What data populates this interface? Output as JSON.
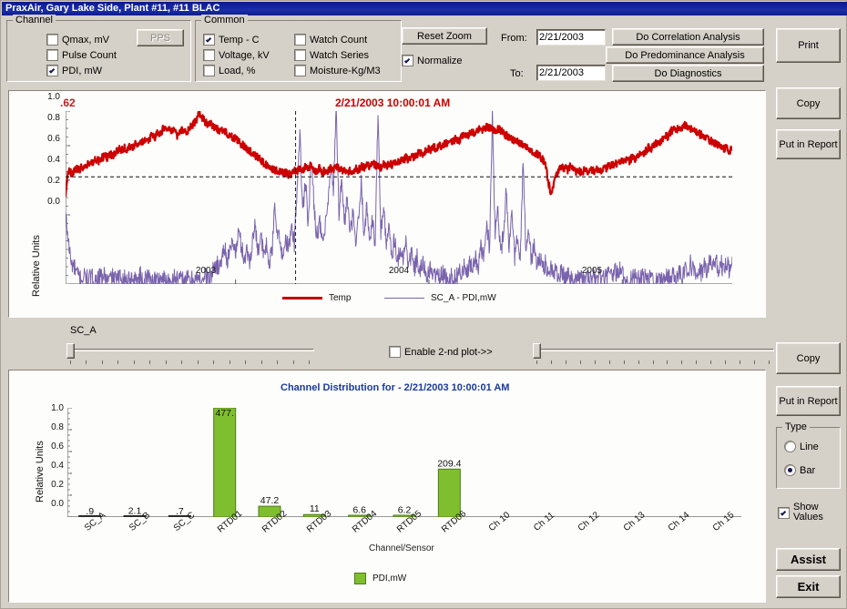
{
  "window": {
    "title": "PraxAir, Gary Lake Side, Plant #11, #11 BLAC"
  },
  "channel_group": {
    "title": "Channel",
    "items": [
      {
        "label": "Qmax, mV",
        "checked": false
      },
      {
        "label": "Pulse Count",
        "checked": false
      },
      {
        "label": "PDI, mW",
        "checked": true
      }
    ],
    "pps_button": "PPS"
  },
  "common_group": {
    "title": "Common",
    "items": [
      {
        "label": "Temp - C",
        "checked": true
      },
      {
        "label": "Voltage, kV",
        "checked": false
      },
      {
        "label": "Load, %",
        "checked": false
      },
      {
        "label": "Watch Count",
        "checked": false
      },
      {
        "label": "Watch Series",
        "checked": false
      },
      {
        "label": "Moisture-Kg/M3",
        "checked": false
      }
    ]
  },
  "zoom_group": {
    "reset_button": "Reset Zoom",
    "normalize_label": "Normalize",
    "normalize_checked": true
  },
  "daterange": {
    "from_label": "From:",
    "from_value": "2/21/2003",
    "to_label": "To:",
    "to_value": "2/21/2003"
  },
  "analysis_buttons": [
    "Do Correlation Analysis",
    "Do Predominance Analysis",
    "Do Diagnostics"
  ],
  "right_top_buttons": [
    "Print",
    "Copy",
    "Put in Report"
  ],
  "right_bottom_buttons": [
    "Copy",
    "Put in Report"
  ],
  "type_group": {
    "title": "Type",
    "options": [
      {
        "label": "Line",
        "selected": false
      },
      {
        "label": "Bar",
        "selected": true
      }
    ]
  },
  "show_values": {
    "label_line1": "Show",
    "label_line2": "Values",
    "checked": true
  },
  "assist_button": "Assist",
  "exit_button": "Exit",
  "slider_section": {
    "channel_label": "SC_A",
    "enable_2nd_plot_label": "Enable 2-nd plot->>",
    "enable_2nd_plot_checked": false
  },
  "colors": {
    "temp_line": "#cc0000",
    "pdi_line": "#7a63ad",
    "bar_fill": "#7fbf2f",
    "bar_edge": "#4c7a18",
    "title_blue": "#1a3a9c",
    "marker_red": "#bb2222",
    "titlebar_blue": "#13249c",
    "face": "#d5d0c8"
  },
  "chart_data": [
    {
      "id": "trend-chart",
      "type": "line",
      "title": "2/21/2003 10:00:01 AM",
      "corner_value": ".62",
      "ylabel": "Relative Units",
      "xlabel": "",
      "ylim": [
        0.0,
        1.0
      ],
      "yticks": [
        "0.0",
        "0.2",
        "0.4",
        "0.6",
        "0.8",
        "1.0"
      ],
      "ytick_values": [
        0.0,
        0.2,
        0.4,
        0.6,
        0.8,
        1.0
      ],
      "xticks": [
        "2003",
        "2004",
        "2005"
      ],
      "xtick_positions": [
        0.255,
        0.545,
        0.835
      ],
      "threshold_line": 0.62,
      "cursor_position": 0.345,
      "legend_position": "bottom",
      "series": [
        {
          "name": "Temp",
          "color": "#cc0000",
          "values": [
            0.51,
            0.66,
            0.64,
            0.65,
            0.67,
            0.66,
            0.68,
            0.67,
            0.69,
            0.7,
            0.71,
            0.72,
            0.71,
            0.73,
            0.74,
            0.73,
            0.75,
            0.74,
            0.76,
            0.78,
            0.77,
            0.79,
            0.78,
            0.8,
            0.79,
            0.81,
            0.8,
            0.82,
            0.83,
            0.82,
            0.84,
            0.86,
            0.85,
            0.88,
            0.87,
            0.9,
            0.89,
            0.91,
            0.88,
            0.9,
            0.86,
            0.88,
            0.9,
            0.87,
            0.89,
            0.91,
            0.93,
            0.95,
            0.99,
            0.96,
            0.94,
            0.92,
            0.93,
            0.91,
            0.9,
            0.89,
            0.9,
            0.88,
            0.87,
            0.86,
            0.85,
            0.84,
            0.82,
            0.81,
            0.8,
            0.78,
            0.77,
            0.76,
            0.74,
            0.73,
            0.72,
            0.7,
            0.69,
            0.68,
            0.67,
            0.66,
            0.65,
            0.66,
            0.64,
            0.65,
            0.63,
            0.64,
            0.66,
            0.65,
            0.67,
            0.66,
            0.68,
            0.67,
            0.69,
            0.66,
            0.65,
            0.67,
            0.64,
            0.66,
            0.65,
            0.67,
            0.66,
            0.68,
            0.67,
            0.66,
            0.65,
            0.64,
            0.66,
            0.65,
            0.67,
            0.66,
            0.68,
            0.67,
            0.69,
            0.68,
            0.7,
            0.69,
            0.68,
            0.67,
            0.69,
            0.68,
            0.7,
            0.69,
            0.71,
            0.7,
            0.72,
            0.71,
            0.73,
            0.72,
            0.74,
            0.73,
            0.75,
            0.76,
            0.75,
            0.77,
            0.78,
            0.77,
            0.79,
            0.78,
            0.8,
            0.79,
            0.81,
            0.82,
            0.81,
            0.83,
            0.84,
            0.83,
            0.85,
            0.86,
            0.85,
            0.87,
            0.88,
            0.87,
            0.89,
            0.9,
            0.89,
            0.91,
            0.9,
            0.89,
            0.88,
            0.9,
            0.89,
            0.87,
            0.86,
            0.85,
            0.84,
            0.83,
            0.82,
            0.81,
            0.8,
            0.79,
            0.78,
            0.77,
            0.76,
            0.75,
            0.74,
            0.72,
            0.7,
            0.6,
            0.52,
            0.58,
            0.63,
            0.66,
            0.68,
            0.67,
            0.66,
            0.68,
            0.67,
            0.65,
            0.66,
            0.64,
            0.66,
            0.65,
            0.67,
            0.66,
            0.65,
            0.67,
            0.66,
            0.68,
            0.67,
            0.69,
            0.68,
            0.7,
            0.69,
            0.71,
            0.7,
            0.72,
            0.71,
            0.73,
            0.72,
            0.74,
            0.76,
            0.75,
            0.77,
            0.79,
            0.78,
            0.8,
            0.82,
            0.81,
            0.84,
            0.86,
            0.85,
            0.88,
            0.9,
            0.89,
            0.91,
            0.9,
            0.92,
            0.91,
            0.89,
            0.9,
            0.88,
            0.87,
            0.86,
            0.85,
            0.84,
            0.83,
            0.82,
            0.81,
            0.8,
            0.79,
            0.78,
            0.79,
            0.77,
            0.78
          ]
        },
        {
          "name": "SC_A - PDI,mW",
          "color": "#7a63ad",
          "values": [
            0.4,
            0.25,
            0.12,
            0.1,
            0.06,
            0.04,
            0.03,
            0.05,
            0.02,
            0.04,
            0.03,
            0.02,
            0.04,
            0.03,
            0.05,
            0.02,
            0.03,
            0.04,
            0.02,
            0.03,
            0.05,
            0.03,
            0.02,
            0.04,
            0.03,
            0.02,
            0.03,
            0.05,
            0.02,
            0.03,
            0.04,
            0.02,
            0.03,
            0.02,
            0.04,
            0.03,
            0.02,
            0.03,
            0.02,
            0.04,
            0.03,
            0.02,
            0.03,
            0.02,
            0.03,
            0.02,
            0.04,
            0.03,
            0.02,
            0.03,
            0.05,
            0.03,
            0.04,
            0.08,
            0.12,
            0.09,
            0.15,
            0.22,
            0.14,
            0.18,
            0.26,
            0.17,
            0.31,
            0.22,
            0.15,
            0.19,
            0.13,
            0.25,
            0.34,
            0.2,
            0.28,
            0.16,
            0.22,
            0.12,
            0.18,
            0.45,
            0.3,
            0.22,
            0.16,
            0.26,
            0.2,
            0.32,
            0.24,
            0.55,
            0.88,
            0.4,
            0.62,
            0.35,
            0.72,
            0.48,
            0.28,
            0.36,
            0.24,
            0.3,
            0.45,
            0.65,
            0.55,
            1.0,
            0.42,
            0.6,
            0.35,
            0.5,
            0.28,
            0.4,
            0.24,
            0.36,
            0.58,
            0.3,
            0.44,
            0.26,
            0.38,
            0.22,
            1.0,
            0.3,
            0.45,
            0.2,
            0.35,
            0.16,
            0.28,
            0.12,
            0.22,
            0.14,
            0.25,
            0.1,
            0.18,
            0.08,
            0.15,
            0.06,
            0.12,
            0.07,
            0.05,
            0.09,
            0.04,
            0.07,
            0.03,
            0.06,
            0.04,
            0.02,
            0.05,
            0.03,
            0.04,
            0.08,
            0.05,
            0.1,
            0.06,
            0.12,
            0.08,
            0.15,
            0.1,
            0.22,
            0.14,
            0.35,
            0.2,
            1.0,
            0.28,
            0.45,
            0.18,
            0.3,
            0.55,
            0.22,
            0.38,
            0.16,
            0.26,
            0.12,
            0.7,
            0.2,
            0.3,
            0.14,
            0.22,
            0.1,
            0.16,
            0.08,
            0.12,
            0.06,
            0.1,
            0.05,
            0.08,
            0.04,
            0.07,
            0.03,
            0.06,
            0.04,
            0.02,
            0.05,
            0.03,
            0.04,
            0.02,
            0.03,
            0.02,
            0.04,
            0.03,
            0.05,
            0.02,
            0.04,
            0.03,
            0.06,
            0.04,
            0.08,
            0.05,
            0.1,
            0.04,
            0.03,
            0.02,
            0.04,
            0.03,
            0.05,
            0.02,
            0.04,
            0.03,
            0.02,
            0.05,
            0.03,
            0.04,
            0.02,
            0.03,
            0.05,
            0.04,
            0.03,
            0.06,
            0.04,
            0.08,
            0.05,
            0.1,
            0.06,
            0.12,
            0.08,
            0.05,
            0.09,
            0.06,
            0.11,
            0.07,
            0.13,
            0.08,
            0.15,
            0.09,
            0.12,
            0.07,
            0.14,
            0.08,
            0.16
          ]
        }
      ]
    },
    {
      "id": "channel-distribution-chart",
      "type": "bar",
      "title": "Channel Distribution for - 2/21/2003 10:00:01 AM",
      "ylabel": "Relative Units",
      "xlabel": "Channel/Sensor",
      "ylim": [
        0.0,
        1.0
      ],
      "yticks": [
        "0.0",
        "0.2",
        "0.4",
        "0.6",
        "0.8",
        "1.0"
      ],
      "ytick_values": [
        0.0,
        0.2,
        0.4,
        0.6,
        0.8,
        1.0
      ],
      "categories": [
        "SC_A",
        "SC_B",
        "SC_C",
        "RTD01",
        "RTD02",
        "RTD03",
        "RTD04",
        "RTD05",
        "RTD06",
        "Ch 10",
        "Ch 11",
        "Ch 12",
        "Ch 13",
        "Ch 14",
        "Ch 15"
      ],
      "values": [
        0.002,
        0.004,
        0.0015,
        1.0,
        0.099,
        0.023,
        0.014,
        0.013,
        0.439,
        0,
        0,
        0,
        0,
        0,
        0
      ],
      "data_labels": [
        ".9",
        "2.1",
        ".7",
        "477.",
        "47.2",
        "11",
        "6.6",
        "6.2",
        "209.4",
        "",
        "",
        "",
        "",
        "",
        ""
      ],
      "raw_values": [
        0.9,
        2.1,
        0.7,
        477.0,
        47.2,
        11.0,
        6.6,
        6.2,
        209.4,
        0,
        0,
        0,
        0,
        0,
        0
      ],
      "series_name": "PDI,mW",
      "bar_color": "#7fbf2f",
      "legend_position": "bottom"
    }
  ]
}
